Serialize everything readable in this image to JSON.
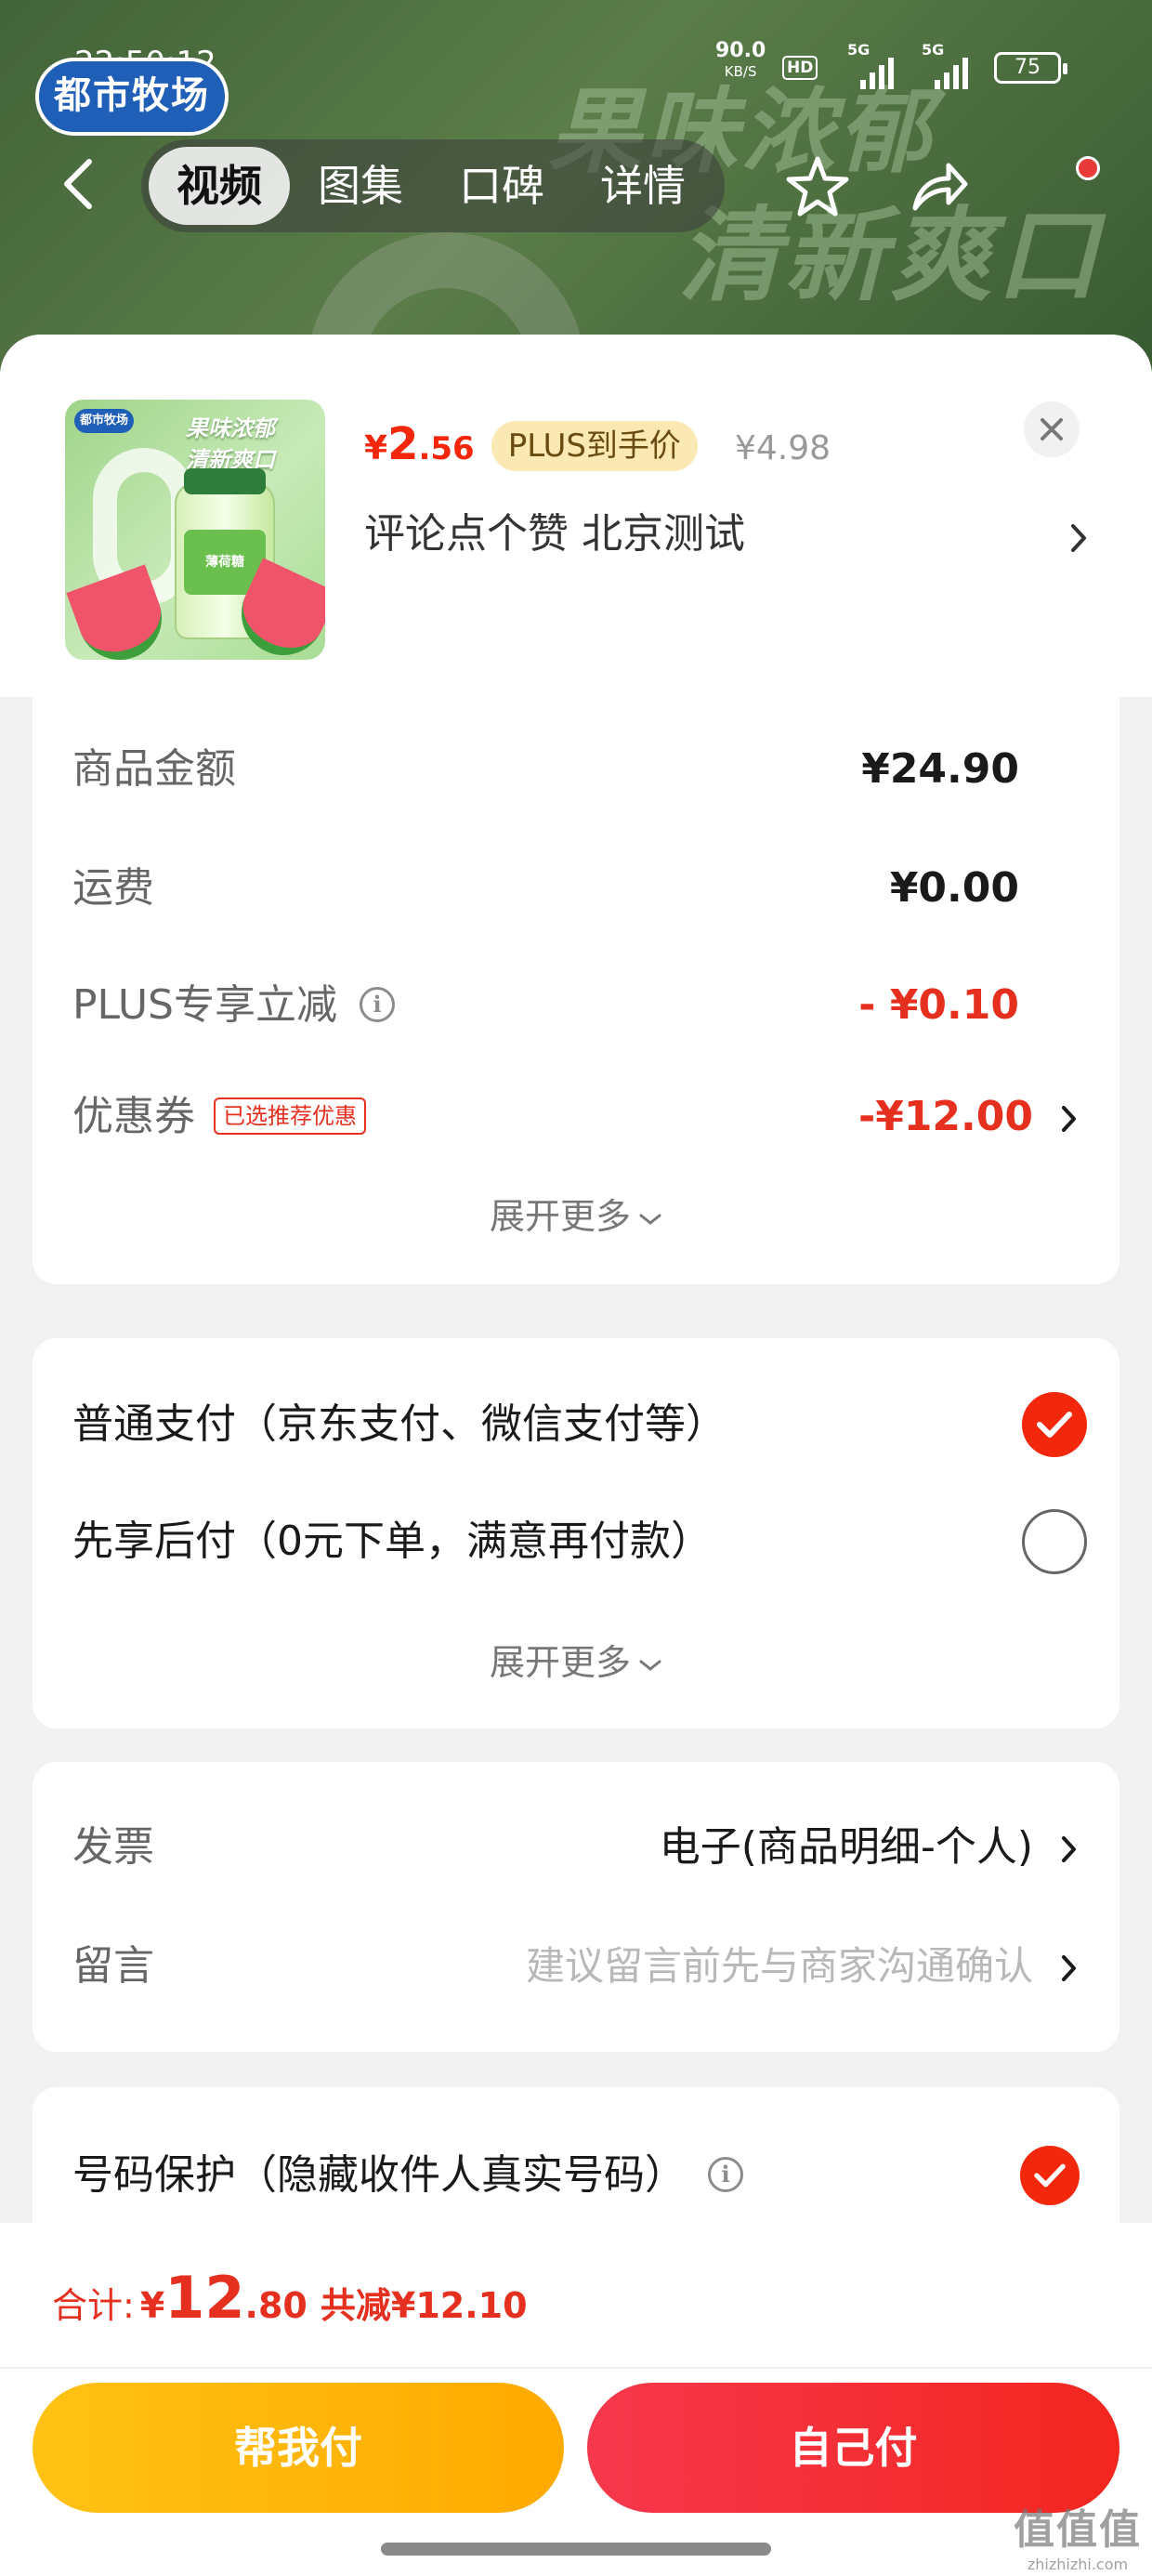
{
  "background": {
    "status_bar": {
      "time": "22:50:12",
      "speed_value": "90.0",
      "speed_unit": "KB/S",
      "hd": "HD",
      "net1": "5G",
      "net2": "5G",
      "battery": "75"
    },
    "brand_logo": "都市牧场",
    "slogan_line1": "果味浓郁",
    "slogan_line2": "清新爽口",
    "tabs": [
      {
        "label": "视频",
        "active": true
      },
      {
        "label": "图集",
        "active": false
      },
      {
        "label": "口碑",
        "active": false
      },
      {
        "label": "详情",
        "active": false
      }
    ]
  },
  "product": {
    "image_brand": "都市牧场",
    "image_slogan1": "果味浓郁",
    "image_slogan2": "清新爽口",
    "image_label": "薄荷糖",
    "price_symbol": "¥",
    "price_int": "2",
    "price_dec": ".56",
    "plus_badge": "PLUS到手价",
    "original_price": "¥4.98",
    "spec": "评论点个赞  北京测试"
  },
  "amounts": [
    {
      "label": "商品金额",
      "value": "¥24.90"
    },
    {
      "label": "运费",
      "value": "¥0.00"
    },
    {
      "label": "PLUS专享立减",
      "value": "- ¥0.10"
    },
    {
      "label": "优惠券",
      "tag": "已选推荐优惠",
      "value": "-¥12.00"
    }
  ],
  "expand_more": "展开更多",
  "payment": [
    {
      "label": "普通支付（京东支付、微信支付等）",
      "selected": true
    },
    {
      "label": "先享后付（0元下单，满意再付款）",
      "selected": false
    }
  ],
  "invoice": {
    "label": "发票",
    "value": "电子(商品明细-个人)"
  },
  "message": {
    "label": "留言",
    "placeholder": "建议留言前先与商家沟通确认"
  },
  "protection": {
    "label": "号码保护（隐藏收件人真实号码）",
    "checked": true
  },
  "total": {
    "label": "合计:",
    "symbol": "¥",
    "int": "12",
    "dec": ".80",
    "saved": "共减¥12.10"
  },
  "buttons": {
    "help_pay": "帮我付",
    "self_pay": "自己付"
  },
  "watermark": {
    "big": "值值值",
    "small": "zhizhizhi.com"
  },
  "colors": {
    "accent_red": "#f2270c",
    "yellow": "#ffb300",
    "plus_badge_bg": "#fbe9b4"
  }
}
